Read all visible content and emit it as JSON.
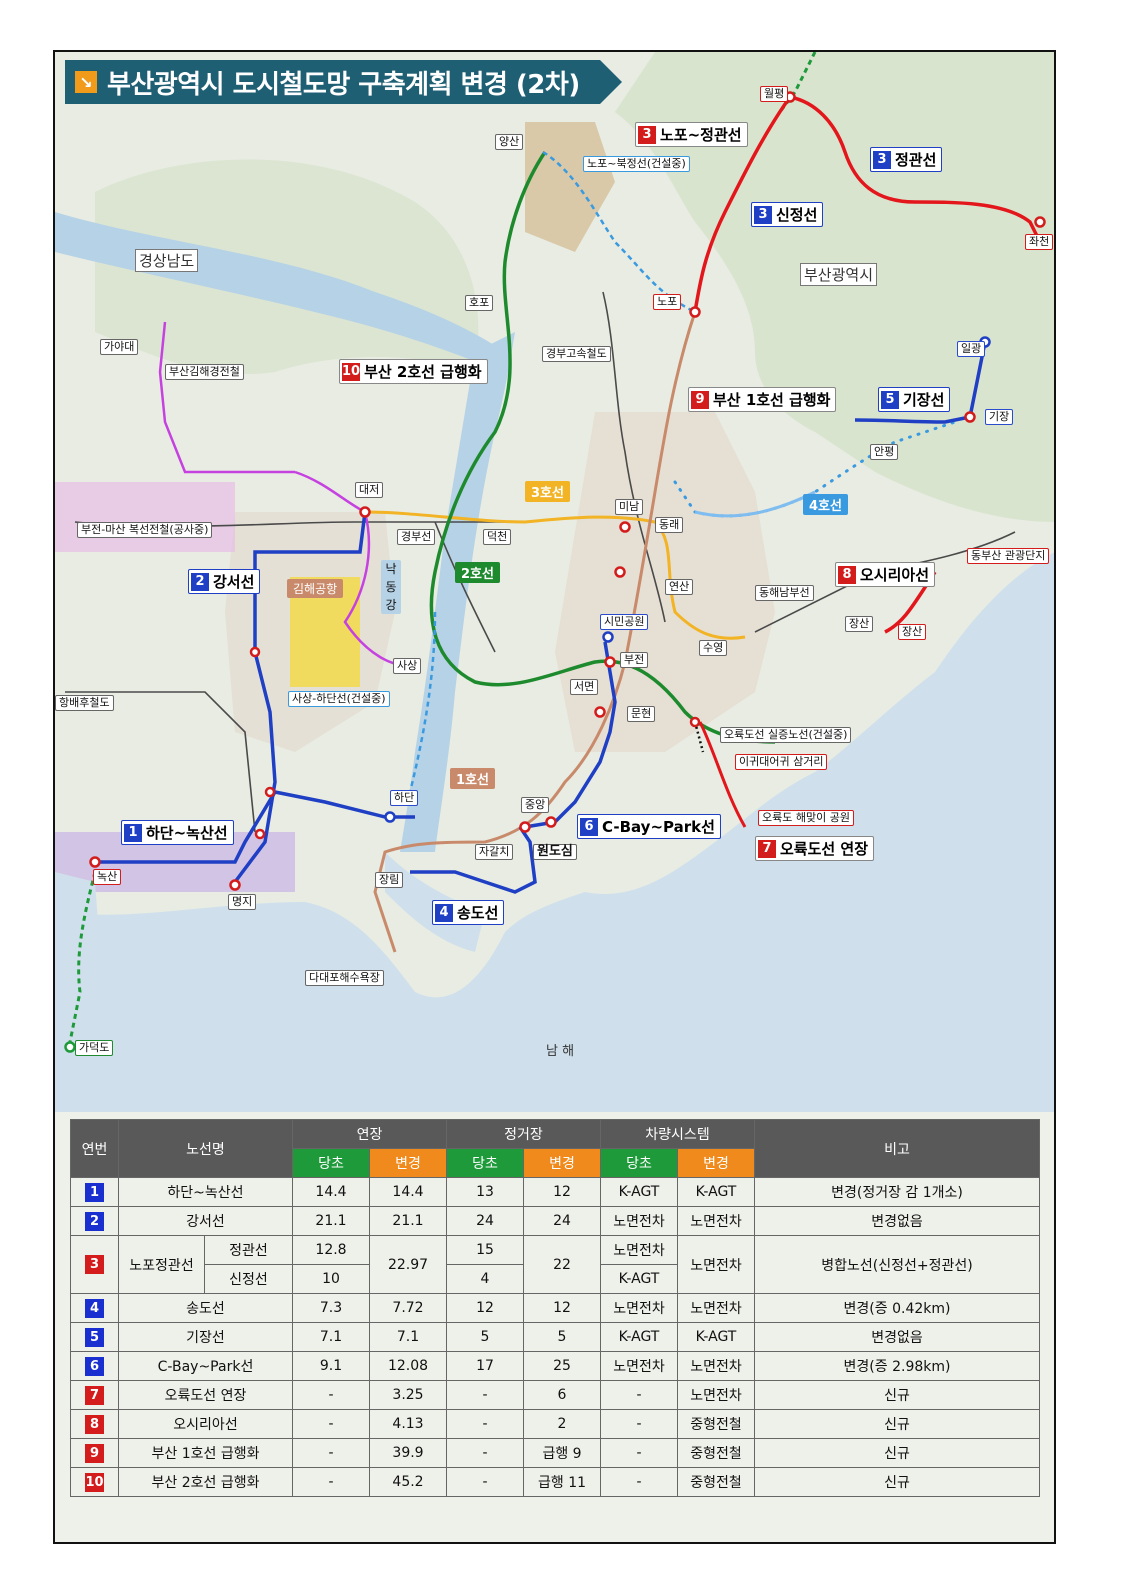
{
  "title": "부산광역시 도시철도망 구축계획 변경 (2차)",
  "title_icon": "arrow-down-right-icon",
  "map": {
    "regions": {
      "gyeongnam": "경상남도",
      "busan": "부산광역시",
      "sea": "남 해"
    },
    "stations": {
      "wolpyeong": "월평",
      "jwacheon": "좌천",
      "nopo": "노포",
      "ilgwang": "일광",
      "gijang": "기장",
      "anpyeong": "안평",
      "daejeo": "대저",
      "mipyeong": "미남",
      "dongrae": "동래",
      "deokcheon": "덕천",
      "yeonsan": "연산",
      "simingongwon": "시민공원",
      "bujeon": "부전",
      "seomyeon": "서면",
      "munhyeon": "문현",
      "suyeong": "수영",
      "sasang": "사상",
      "hadan": "하단",
      "jungang": "중앙",
      "wondosim": "원도심",
      "jagalchi": "자갈치",
      "jangrim": "장림",
      "noksan": "녹산",
      "myeongji": "명지",
      "gadeokdo": "가덕도",
      "dadaepo": "다대포해수욕장",
      "jangsan": "장산",
      "jangsan2": "장산",
      "yangsan": "양산",
      "hopo": "호포",
      "gayadae": "가야대",
      "eguidaegwi": "이귀대어귀 삼거리",
      "oryukdo_park": "오륙도 해맞이 공원",
      "dongbusan": "동부산 관광단지"
    },
    "line_labels": {
      "nopo_jeonggwan": {
        "num": "3",
        "text": "노포~정관선"
      },
      "jeonggwan": {
        "num": "3",
        "text": "정관선"
      },
      "sinjeong": {
        "num": "3",
        "text": "신정선"
      },
      "gijang": {
        "num": "5",
        "text": "기장선"
      },
      "line1_express": {
        "num": "9",
        "text": "부산 1호선 급행화"
      },
      "line2_express": {
        "num": "10",
        "text": "부산 2호선 급행화"
      },
      "gangseo": {
        "num": "2",
        "text": "강서선"
      },
      "osiria": {
        "num": "8",
        "text": "오시리아선"
      },
      "hadan_noksan": {
        "num": "1",
        "text": "하단~녹산선"
      },
      "cbay": {
        "num": "6",
        "text": "C-Bay~Park선"
      },
      "songdo": {
        "num": "4",
        "text": "송도선"
      },
      "oryukdo_ext": {
        "num": "7",
        "text": "오륙도선 연장"
      }
    },
    "other_labels": {
      "nopo_bukjeong": "노포~북정선(건설중)",
      "busan_gimhae": "부산김해경전철",
      "gyeongbu_rail": "경부고속철도",
      "bujeon_masan": "부전-마산 복선전철(공사중)",
      "gyeongbu_line": "경부선",
      "gimhae_airport": "김해공항",
      "nakdong": "낙동강",
      "sasang_hadan": "사상-하단선(건설중)",
      "donghae_nambu": "동해남부선",
      "oryukdo_light": "오륙도선 실증노선(건설중)",
      "hangbae": "항배후철도",
      "line3_tag": "3호선",
      "line2_tag": "2호선",
      "line4_tag": "4호선",
      "line1_tag": "1호선"
    }
  },
  "table": {
    "headers": {
      "no": "연번",
      "name": "노선명",
      "length": "연장",
      "stations": "정거장",
      "vehicle": "차량시스템",
      "note": "비고",
      "before": "당초",
      "after": "변경"
    },
    "rows": [
      {
        "no": "1",
        "color": "#1a2fd0",
        "name": "하단~녹산선",
        "len_b": "14.4",
        "len_a": "14.4",
        "st_b": "13",
        "st_a": "12",
        "veh_b": "K-AGT",
        "veh_a": "K-AGT",
        "note": "변경(정거장 감 1개소)"
      },
      {
        "no": "2",
        "color": "#1a2fd0",
        "name": "강서선",
        "len_b": "21.1",
        "len_a": "21.1",
        "st_b": "24",
        "st_a": "24",
        "veh_b": "노면전차",
        "veh_a": "노면전차",
        "note": "변경없음"
      },
      {
        "no": "3",
        "color": "#d41c1c",
        "name": "노포정관선",
        "sub1": "정관선",
        "sub2": "신정선",
        "len_b1": "12.8",
        "len_b2": "10",
        "len_a": "22.97",
        "st_b1": "15",
        "st_b2": "4",
        "st_a": "22",
        "veh_b1": "노면전차",
        "veh_b2": "K-AGT",
        "veh_a": "노면전차",
        "note": "병합노선(신정선+정관선)"
      },
      {
        "no": "4",
        "color": "#1a2fd0",
        "name": "송도선",
        "len_b": "7.3",
        "len_a": "7.72",
        "st_b": "12",
        "st_a": "12",
        "veh_b": "노면전차",
        "veh_a": "노면전차",
        "note": "변경(증 0.42km)"
      },
      {
        "no": "5",
        "color": "#1a2fd0",
        "name": "기장선",
        "len_b": "7.1",
        "len_a": "7.1",
        "st_b": "5",
        "st_a": "5",
        "veh_b": "K-AGT",
        "veh_a": "K-AGT",
        "note": "변경없음"
      },
      {
        "no": "6",
        "color": "#1a2fd0",
        "name": "C-Bay~Park선",
        "len_b": "9.1",
        "len_a": "12.08",
        "st_b": "17",
        "st_a": "25",
        "veh_b": "노면전차",
        "veh_a": "노면전차",
        "note": "변경(증 2.98km)"
      },
      {
        "no": "7",
        "color": "#d41c1c",
        "name": "오륙도선 연장",
        "len_b": "-",
        "len_a": "3.25",
        "st_b": "-",
        "st_a": "6",
        "veh_b": "-",
        "veh_a": "노면전차",
        "note": "신규"
      },
      {
        "no": "8",
        "color": "#d41c1c",
        "name": "오시리아선",
        "len_b": "-",
        "len_a": "4.13",
        "st_b": "-",
        "st_a": "2",
        "veh_b": "-",
        "veh_a": "중형전철",
        "note": "신규"
      },
      {
        "no": "9",
        "color": "#d41c1c",
        "name": "부산 1호선 급행화",
        "len_b": "-",
        "len_a": "39.9",
        "st_b": "-",
        "st_a": "급행 9",
        "veh_b": "-",
        "veh_a": "중형전철",
        "note": "신규"
      },
      {
        "no": "10",
        "color": "#d41c1c",
        "name": "부산 2호선 급행화",
        "len_b": "-",
        "len_a": "45.2",
        "st_b": "-",
        "st_a": "급행 11",
        "veh_b": "-",
        "veh_a": "중형전철",
        "note": "신규"
      }
    ]
  },
  "colors": {
    "red": "#d41c1c",
    "blue": "#1a2fd0",
    "green": "#1e9a3a",
    "orange": "#f08a1c",
    "header": "#595959",
    "teal": "#1f5f74"
  }
}
